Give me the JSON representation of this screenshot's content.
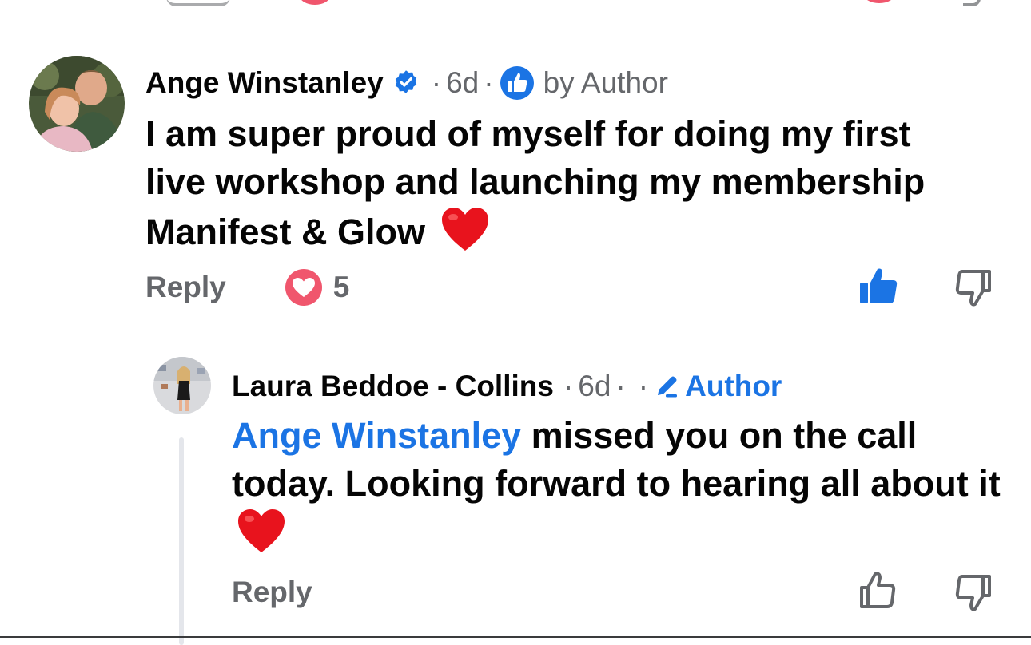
{
  "comments": [
    {
      "author": "Ange Winstanley",
      "verified": true,
      "separator": "·",
      "time": "6d",
      "badge_label": "by Author",
      "text": "I am super proud of myself for doing my first live workshop and launching my membership Manifest & Glow",
      "emoji": "❤️",
      "reply_label": "Reply",
      "reaction_count": "5",
      "liked": true
    },
    {
      "author": "Laura Beddoe - Collins",
      "separator": "·",
      "time": "6d",
      "badge_label": "Author",
      "mention": "Ange Winstanley",
      "text": " missed you on the call today. Looking forward to hearing all about it",
      "emoji": "❤️",
      "reply_label": "Reply",
      "liked": false
    }
  ],
  "colors": {
    "accent": "#1b74e4",
    "secondary_text": "#65676b",
    "love_reaction": "#f0566d"
  },
  "icons": {
    "verified": "verified-badge-icon",
    "top_fan": "thumbs-up-circle-icon",
    "author_badge": "pencil-icon",
    "love": "heart-reaction-icon",
    "like": "thumbs-up-icon",
    "dislike": "thumbs-down-icon"
  }
}
